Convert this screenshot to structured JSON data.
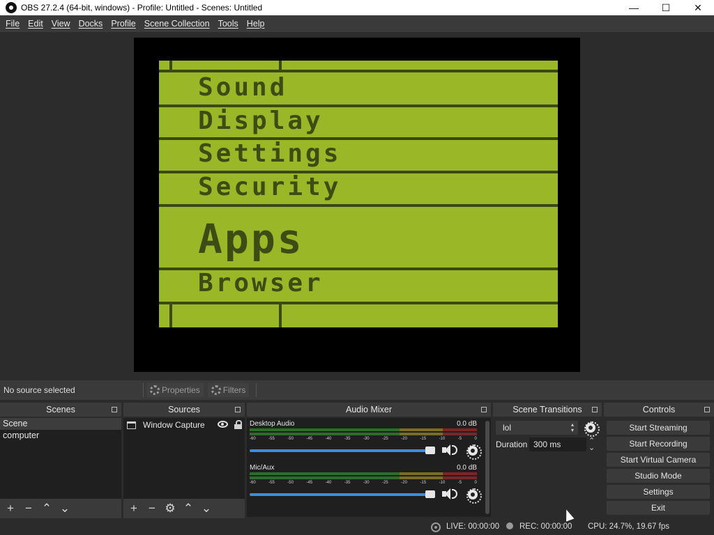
{
  "window": {
    "title": "OBS 27.2.4 (64-bit, windows) - Profile: Untitled - Scenes: Untitled",
    "minimize": "—",
    "maximize": "☐",
    "close": "✕"
  },
  "menu": [
    "File",
    "Edit",
    "View",
    "Docks",
    "Profile",
    "Scene Collection",
    "Tools",
    "Help"
  ],
  "preview": {
    "menu_items": [
      "Sound",
      "Display",
      "Settings",
      "Security",
      "Apps",
      "Browser"
    ]
  },
  "source_toolbar": {
    "status": "No source selected",
    "properties_label": "Properties",
    "filters_label": "Filters"
  },
  "scenes": {
    "title": "Scenes",
    "items": [
      "Scene",
      "computer"
    ]
  },
  "sources": {
    "title": "Sources",
    "items": [
      {
        "name": "Window Capture",
        "icon": "window-icon"
      }
    ]
  },
  "audio_mixer": {
    "title": "Audio Mixer",
    "scale": [
      "-60",
      "-55",
      "-50",
      "-45",
      "-40",
      "-35",
      "-30",
      "-25",
      "-20",
      "-15",
      "-10",
      "-5",
      "0"
    ],
    "channels": [
      {
        "name": "Desktop Audio",
        "db": "0.0 dB",
        "volume": 1.0
      },
      {
        "name": "Mic/Aux",
        "db": "0.0 dB",
        "volume": 1.0
      }
    ]
  },
  "scene_transitions": {
    "title": "Scene Transitions",
    "selected": "lol",
    "duration_label": "Duration",
    "duration_value": "300 ms"
  },
  "controls": {
    "title": "Controls",
    "buttons": [
      "Start Streaming",
      "Start Recording",
      "Start Virtual Camera",
      "Studio Mode",
      "Settings",
      "Exit"
    ]
  },
  "status": {
    "live": "LIVE: 00:00:00",
    "rec": "REC: 00:00:00",
    "cpu": "CPU: 24.7%, 19.67 fps"
  },
  "colors": {
    "lcd_background": "#99b726",
    "lcd_ink": "#3c4c14",
    "accent": "#3a8ee0"
  }
}
